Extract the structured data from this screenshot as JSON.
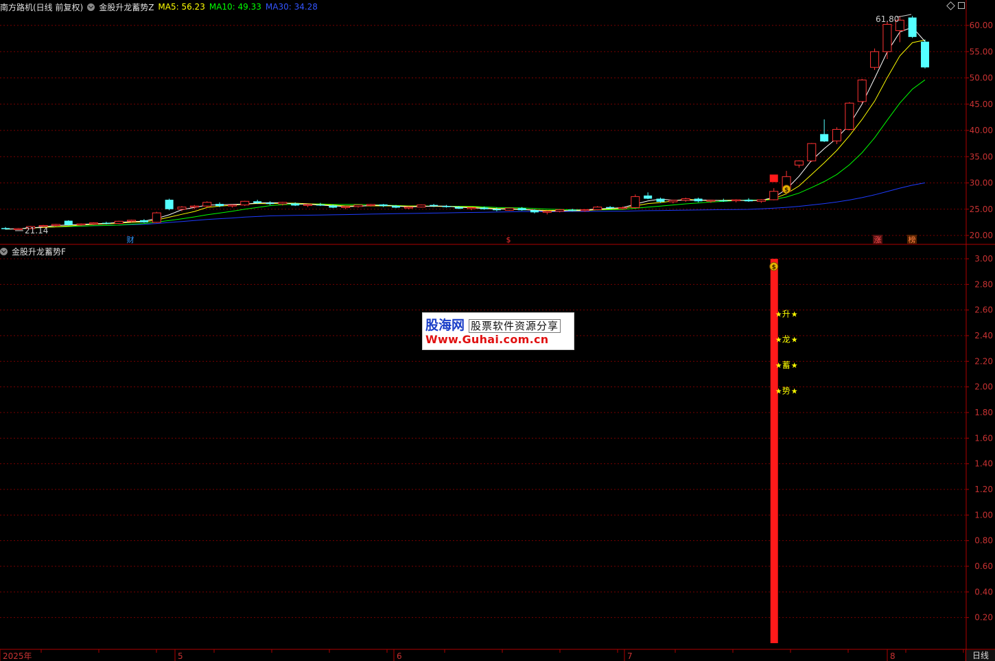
{
  "header": {
    "stock": "南方路机(日线 前复权)",
    "indicator": "金股升龙蓄势Z",
    "ma5_label": "MA5: 56.23",
    "ma10_label": "MA10: 49.33",
    "ma30_label": "MA30: 34.28"
  },
  "indicator_panel": {
    "title": "金股升龙蓄势F"
  },
  "price_axis": [
    "60.00",
    "55.00",
    "50.00",
    "45.00",
    "40.00",
    "35.00",
    "30.00",
    "25.00",
    "20.00"
  ],
  "indicator_axis": [
    "3.00",
    "2.80",
    "2.60",
    "2.40",
    "2.20",
    "2.00",
    "1.80",
    "1.60",
    "1.40",
    "1.20",
    "1.00",
    "0.80",
    "0.60",
    "0.40",
    "0.20"
  ],
  "annotations": {
    "high": "61.80",
    "low": "21.14"
  },
  "event_markers": [
    {
      "name": "finance",
      "label": "财"
    },
    {
      "name": "dollar",
      "label": "$"
    },
    {
      "name": "limit-up",
      "label": "涨"
    },
    {
      "name": "rank",
      "label": "榜"
    }
  ],
  "signal_labels": [
    "升",
    "龙",
    "蓄",
    "势"
  ],
  "timeline": [
    "2025年",
    "5",
    "6",
    "7",
    "8"
  ],
  "period_tab": "日线",
  "watermark": {
    "brand": "股海网",
    "slogan": "股票软件资源分享",
    "url": "Www.Guhai.com.cn"
  },
  "colors": {
    "up": "#ff3232",
    "down": "#54ffff",
    "ma5": "#ffffff",
    "ma10": "#ffff00",
    "ma30": "#00ff00",
    "ma60": "#1e3cff",
    "grid": "#7a0000",
    "signal_bar": "#ff1a1a",
    "axis_text": "#c83232"
  },
  "icons": [
    "money-bag-icon",
    "star-icon",
    "diamond-icon",
    "chevron-down-icon"
  ],
  "chart_data": {
    "type": "candlestick",
    "price_range": [
      20,
      62
    ],
    "indicator_range": [
      0,
      3
    ],
    "candles_ohlc": [
      [
        21.4,
        21.6,
        21.1,
        21.2
      ],
      [
        21.2,
        21.4,
        21.14,
        21.3
      ],
      [
        21.3,
        21.8,
        21.2,
        21.7
      ],
      [
        21.7,
        22.0,
        21.5,
        21.9
      ],
      [
        21.9,
        22.2,
        21.7,
        22.1
      ],
      [
        22.8,
        22.9,
        21.9,
        22.0
      ],
      [
        22.0,
        22.3,
        21.8,
        22.2
      ],
      [
        22.2,
        22.5,
        22.0,
        22.4
      ],
      [
        22.4,
        22.6,
        22.1,
        22.3
      ],
      [
        22.3,
        22.8,
        22.2,
        22.7
      ],
      [
        22.7,
        23.0,
        22.5,
        22.9
      ],
      [
        22.9,
        23.1,
        22.4,
        22.5
      ],
      [
        22.5,
        24.5,
        22.4,
        24.3
      ],
      [
        26.8,
        27.0,
        24.8,
        25.0
      ],
      [
        25.0,
        25.6,
        24.6,
        25.4
      ],
      [
        25.4,
        25.8,
        25.0,
        25.6
      ],
      [
        25.6,
        26.5,
        25.3,
        26.3
      ],
      [
        26.0,
        26.3,
        25.4,
        25.6
      ],
      [
        25.6,
        25.9,
        25.3,
        25.8
      ],
      [
        25.8,
        26.6,
        25.6,
        26.5
      ],
      [
        26.5,
        26.8,
        26.0,
        26.2
      ],
      [
        26.2,
        26.5,
        25.8,
        26.0
      ],
      [
        26.0,
        26.4,
        25.7,
        26.3
      ],
      [
        26.1,
        26.3,
        25.6,
        25.7
      ],
      [
        25.7,
        26.0,
        25.4,
        25.9
      ],
      [
        25.9,
        26.2,
        25.6,
        25.7
      ],
      [
        25.7,
        25.9,
        25.2,
        25.3
      ],
      [
        25.3,
        25.6,
        25.0,
        25.5
      ],
      [
        25.5,
        25.9,
        25.3,
        25.8
      ],
      [
        25.8,
        26.0,
        25.5,
        25.9
      ],
      [
        25.9,
        26.0,
        25.4,
        25.6
      ],
      [
        25.6,
        25.8,
        25.2,
        25.3
      ],
      [
        25.3,
        25.5,
        25.0,
        25.4
      ],
      [
        25.4,
        25.9,
        25.3,
        25.8
      ],
      [
        25.8,
        26.0,
        25.4,
        25.6
      ],
      [
        25.6,
        25.8,
        25.3,
        25.4
      ],
      [
        25.4,
        25.6,
        25.0,
        25.1
      ],
      [
        25.1,
        25.4,
        24.8,
        25.3
      ],
      [
        25.3,
        25.5,
        24.9,
        25.0
      ],
      [
        25.0,
        25.3,
        24.6,
        24.8
      ],
      [
        24.8,
        25.3,
        24.7,
        25.2
      ],
      [
        25.2,
        25.4,
        24.7,
        24.8
      ],
      [
        24.8,
        25.0,
        24.2,
        24.4
      ],
      [
        24.4,
        24.7,
        24.0,
        24.6
      ],
      [
        24.6,
        25.0,
        24.4,
        24.9
      ],
      [
        24.9,
        25.1,
        24.6,
        24.8
      ],
      [
        24.8,
        25.0,
        24.5,
        24.9
      ],
      [
        24.9,
        25.6,
        24.8,
        25.4
      ],
      [
        25.4,
        25.6,
        25.0,
        25.2
      ],
      [
        25.2,
        25.5,
        24.9,
        25.3
      ],
      [
        25.3,
        27.8,
        25.2,
        27.4
      ],
      [
        27.6,
        28.2,
        26.9,
        27.0
      ],
      [
        27.0,
        27.2,
        26.2,
        26.4
      ],
      [
        26.4,
        26.8,
        26.1,
        26.7
      ],
      [
        26.7,
        27.2,
        26.4,
        27.0
      ],
      [
        27.0,
        27.2,
        26.3,
        26.5
      ],
      [
        26.5,
        26.8,
        26.2,
        26.7
      ],
      [
        26.7,
        27.0,
        26.4,
        26.6
      ],
      [
        26.6,
        26.9,
        26.3,
        26.8
      ],
      [
        26.8,
        27.1,
        26.4,
        26.5
      ],
      [
        26.5,
        26.9,
        26.2,
        26.8
      ],
      [
        26.8,
        29.0,
        26.7,
        28.4
      ],
      [
        28.4,
        32.3,
        28.3,
        31.2
      ],
      [
        33.4,
        34.3,
        32.9,
        34.2
      ],
      [
        34.2,
        37.6,
        34.0,
        37.5
      ],
      [
        39.3,
        42.1,
        37.8,
        37.9
      ],
      [
        38.0,
        40.6,
        37.4,
        40.2
      ],
      [
        40.2,
        45.4,
        40.0,
        45.2
      ],
      [
        45.5,
        49.8,
        45.2,
        49.6
      ],
      [
        52.0,
        55.6,
        51.5,
        55.0
      ],
      [
        55.0,
        60.8,
        53.6,
        60.2
      ],
      [
        59.0,
        61.8,
        56.8,
        61.0
      ],
      [
        61.5,
        61.8,
        57.6,
        57.8
      ],
      [
        56.9,
        57.3,
        51.8,
        52.0
      ]
    ],
    "signal_bar": {
      "value": 3.0,
      "labels": [
        "升",
        "龙",
        "蓄",
        "势"
      ]
    }
  }
}
